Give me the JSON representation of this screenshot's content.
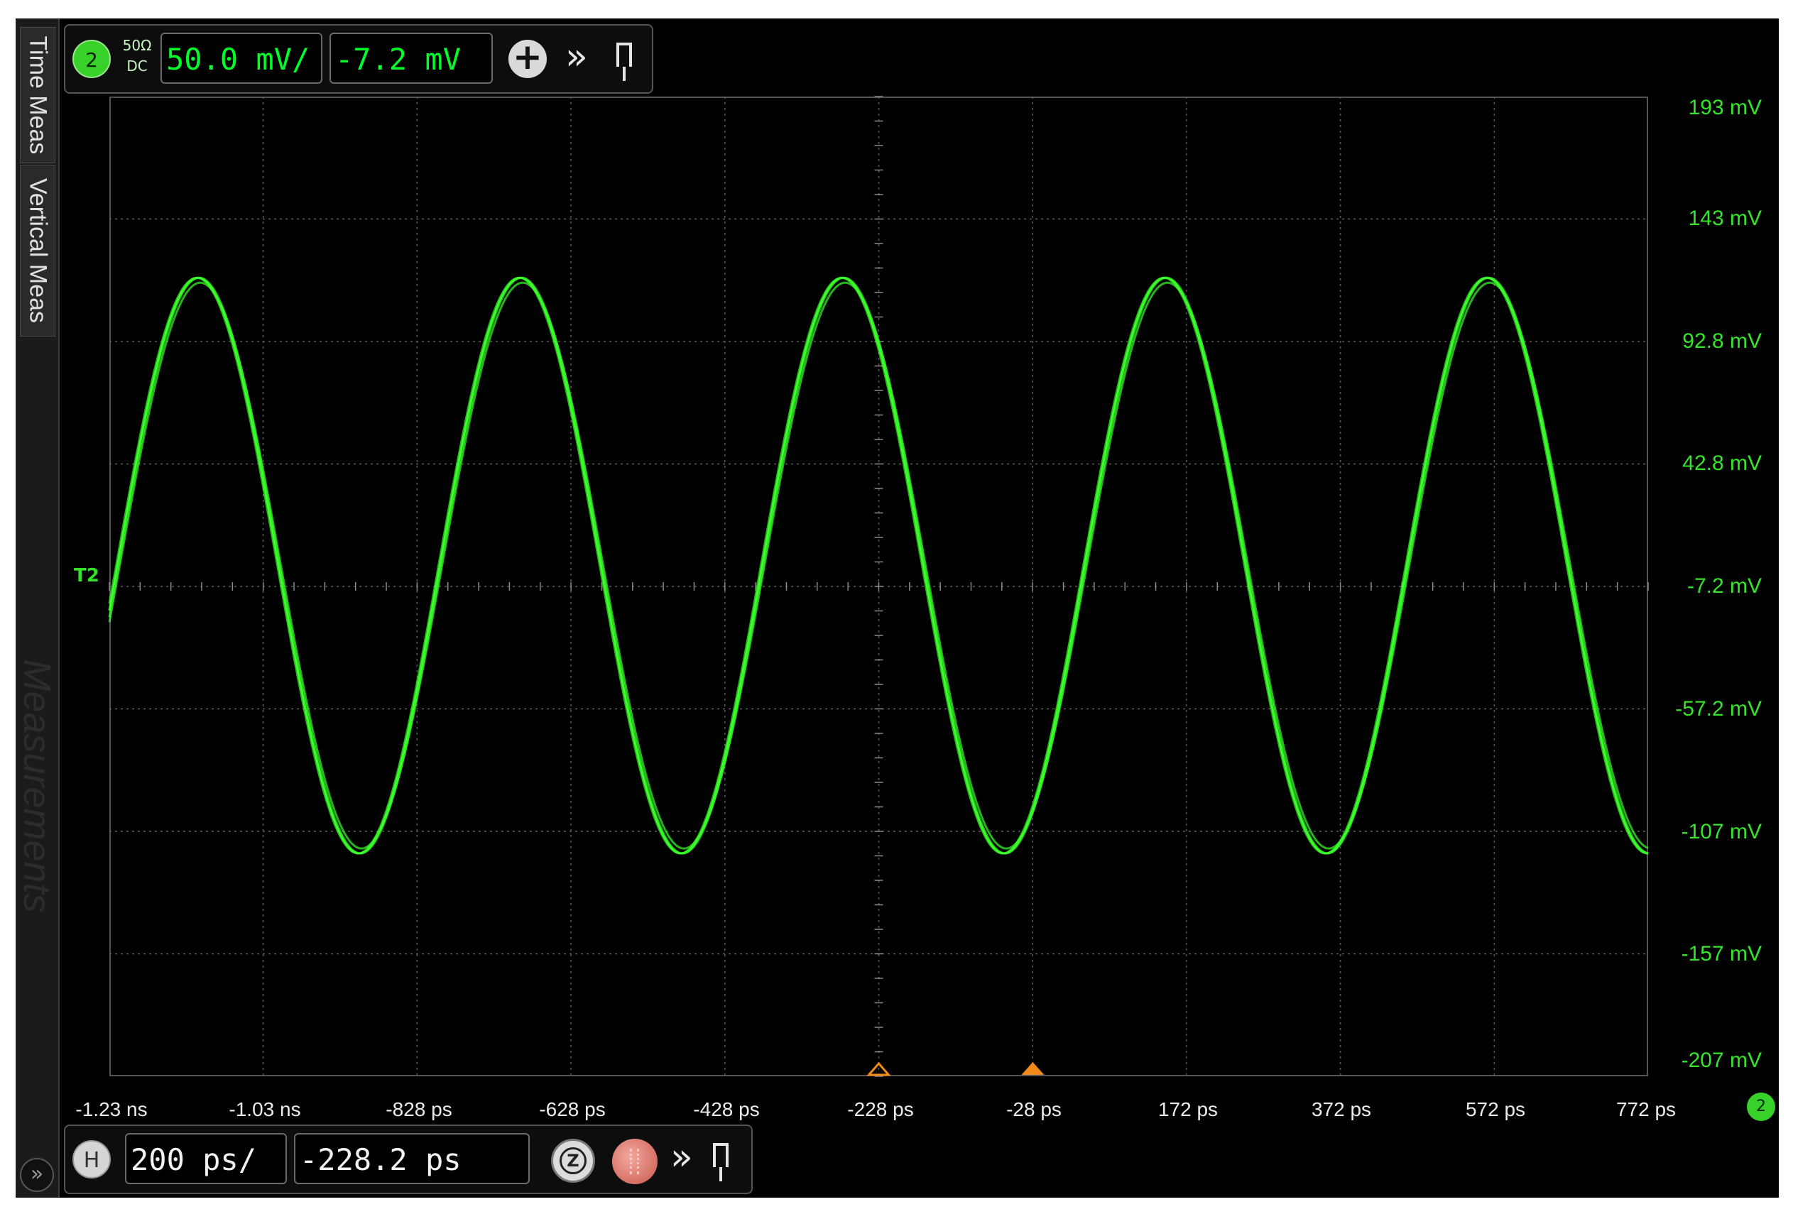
{
  "side_tabs": {
    "time_meas": "Time Meas",
    "vertical_meas": "Vertical Meas",
    "watermark": "Measurements",
    "expand_icon": "double-chevron-right-icon"
  },
  "channel_bar": {
    "channel_number": "2",
    "impedance": "50Ω",
    "coupling": "DC",
    "scale": "50.0 mV/",
    "offset": "-7.2 mV",
    "plus_icon": "plus-icon",
    "more_icon": "double-chevron-right-icon",
    "pin_icon": "pin-icon"
  },
  "horizontal_bar": {
    "badge": "H",
    "timebase": "200 ps/",
    "position": "-228.2 ps",
    "zoom_label": "Z",
    "zoom_icon": "zoom-icon",
    "run_stop_icon": "run-stop-icon",
    "more_icon": "double-chevron-right-icon",
    "pin_icon": "pin-icon"
  },
  "y_axis_labels": [
    "193 mV",
    "143 mV",
    "92.8 mV",
    "42.8 mV",
    "-7.2 mV",
    "-57.2 mV",
    "-107 mV",
    "-157 mV",
    "-207 mV"
  ],
  "x_axis_labels": [
    "-1.23 ns",
    "-1.03 ns",
    "-828 ps",
    "-628 ps",
    "-428 ps",
    "-228 ps",
    "-28 ps",
    "172 ps",
    "372 ps",
    "572 ps",
    "772 ps"
  ],
  "ground_marker": "T2",
  "channel_ref_badge": "2",
  "colors": {
    "trace": "#3bff2b",
    "axis_label": "#36e52b",
    "trigger_marker": "#f08a1a",
    "grid": "#5a5a5a"
  },
  "chart_data": {
    "type": "line",
    "xlabel": "",
    "ylabel": "",
    "x_unit": "ps",
    "y_unit": "mV",
    "xlim": [
      -1228.2,
      771.8
    ],
    "ylim": [
      -207.2,
      192.8
    ],
    "grid": true,
    "series": [
      {
        "waveform": "sine",
        "period_ps": 419,
        "amplitude_mV": 117.5,
        "offset_mV": 1.3,
        "first_peak_ps": -1113,
        "x": [
          -1228.2,
          -1113,
          -904,
          -694,
          -485,
          -275,
          -66,
          143,
          353,
          562,
          771.8
        ],
        "values": [
          40,
          118,
          -116,
          118,
          -116,
          118,
          -116,
          118,
          -116,
          118,
          -90
        ]
      }
    ],
    "markers": {
      "trigger_time_ps": -28,
      "reference_time_ps": -228.2
    }
  }
}
